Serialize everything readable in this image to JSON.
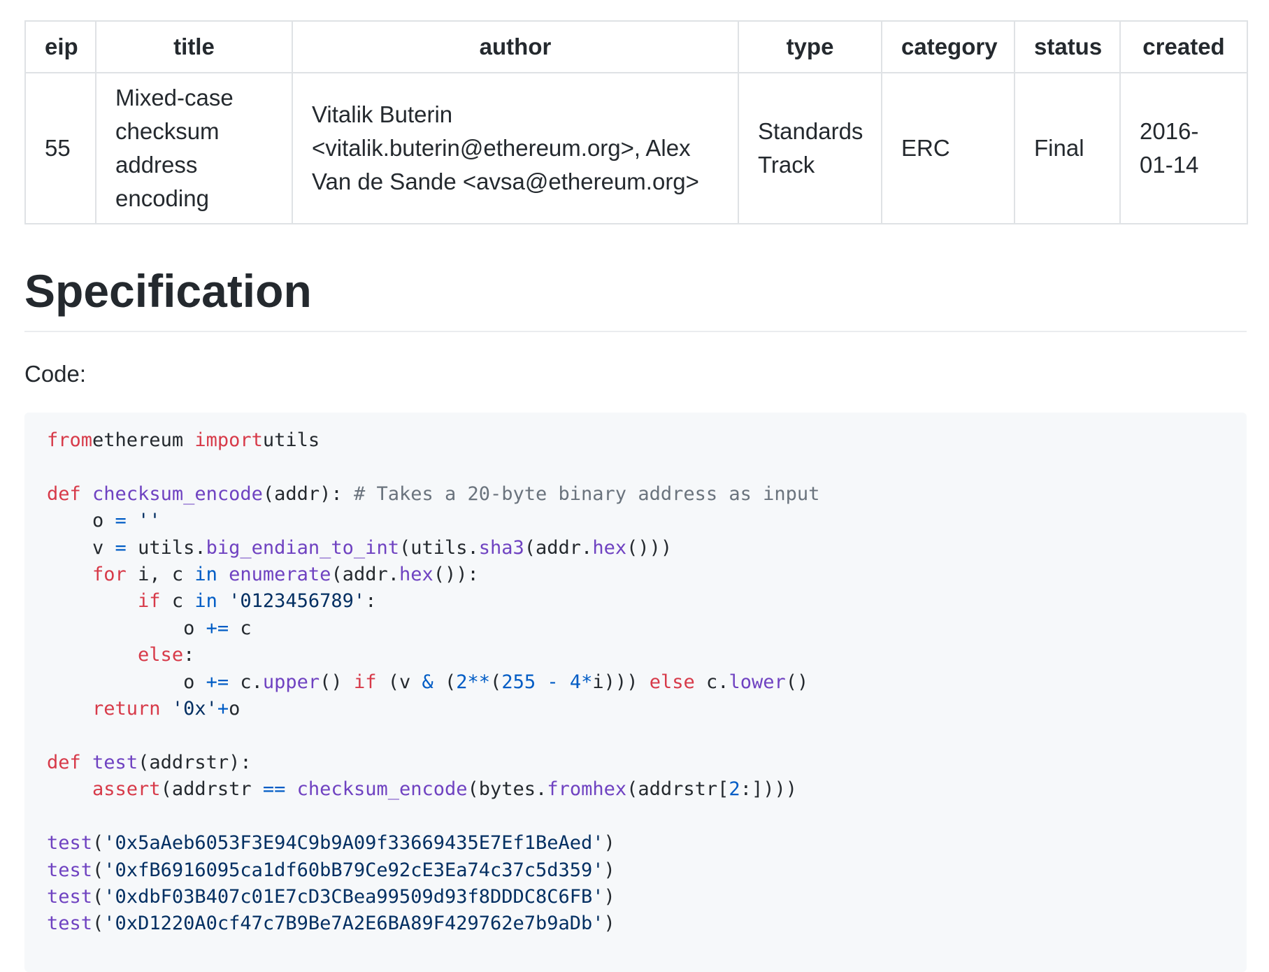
{
  "table": {
    "headers": [
      "eip",
      "title",
      "author",
      "type",
      "category",
      "status",
      "created"
    ],
    "row": {
      "eip": "55",
      "title_lines": [
        "Mixed-case",
        "checksum",
        "address",
        "encoding"
      ],
      "author_lines": [
        "Vitalik Buterin",
        "<vitalik.buterin@ethereum.org>, Alex",
        "Van de Sande <avsa@ethereum.org>"
      ],
      "type_lines": [
        "Standards",
        "Track"
      ],
      "category": "ERC",
      "status": "Final",
      "created_lines": [
        "2016-",
        "01-14"
      ]
    }
  },
  "section_heading": "Specification",
  "code_label": "Code:",
  "code_lines": [
    [
      [
        "k",
        "from"
      ],
      [
        "",
        "ethereum "
      ],
      [
        "k",
        "import"
      ],
      [
        "",
        "utils"
      ]
    ],
    [],
    [
      [
        "k",
        "def"
      ],
      [
        "",
        " "
      ],
      [
        "f",
        "checksum_encode"
      ],
      [
        "",
        "(addr): "
      ],
      [
        "c",
        "# Takes a 20-byte binary address as input"
      ]
    ],
    [
      [
        "",
        "    o "
      ],
      [
        "n",
        "="
      ],
      [
        "",
        " "
      ],
      [
        "s",
        "''"
      ]
    ],
    [
      [
        "",
        "    v "
      ],
      [
        "n",
        "="
      ],
      [
        "",
        " utils."
      ],
      [
        "f",
        "big_endian_to_int"
      ],
      [
        "",
        "(utils."
      ],
      [
        "f",
        "sha3"
      ],
      [
        "",
        "(addr."
      ],
      [
        "f",
        "hex"
      ],
      [
        "",
        "()))"
      ]
    ],
    [
      [
        "",
        "    "
      ],
      [
        "k",
        "for"
      ],
      [
        "",
        " i, c "
      ],
      [
        "n",
        "in"
      ],
      [
        "",
        " "
      ],
      [
        "f",
        "enumerate"
      ],
      [
        "",
        "(addr."
      ],
      [
        "f",
        "hex"
      ],
      [
        "",
        "()):"
      ]
    ],
    [
      [
        "",
        "        "
      ],
      [
        "k",
        "if"
      ],
      [
        "",
        " c "
      ],
      [
        "n",
        "in"
      ],
      [
        "",
        " "
      ],
      [
        "s",
        "'0123456789'"
      ],
      [
        "",
        ":"
      ]
    ],
    [
      [
        "",
        "            o "
      ],
      [
        "n",
        "+="
      ],
      [
        "",
        " c"
      ]
    ],
    [
      [
        "",
        "        "
      ],
      [
        "k",
        "else"
      ],
      [
        "",
        ":"
      ]
    ],
    [
      [
        "",
        "            o "
      ],
      [
        "n",
        "+="
      ],
      [
        "",
        " c."
      ],
      [
        "f",
        "upper"
      ],
      [
        "",
        "() "
      ],
      [
        "k",
        "if"
      ],
      [
        "",
        " (v "
      ],
      [
        "n",
        "&"
      ],
      [
        "",
        " ("
      ],
      [
        "n",
        "2"
      ],
      [
        "n",
        "**"
      ],
      [
        "",
        "("
      ],
      [
        "n",
        "255"
      ],
      [
        "",
        " "
      ],
      [
        "n",
        "-"
      ],
      [
        "",
        " "
      ],
      [
        "n",
        "4"
      ],
      [
        "n",
        "*"
      ],
      [
        "",
        "i))) "
      ],
      [
        "k",
        "else"
      ],
      [
        "",
        " c."
      ],
      [
        "f",
        "lower"
      ],
      [
        "",
        "()"
      ]
    ],
    [
      [
        "",
        "    "
      ],
      [
        "k",
        "return"
      ],
      [
        "",
        " "
      ],
      [
        "s",
        "'0x'"
      ],
      [
        "n",
        "+"
      ],
      [
        "",
        "o"
      ]
    ],
    [],
    [
      [
        "k",
        "def"
      ],
      [
        "",
        " "
      ],
      [
        "f",
        "test"
      ],
      [
        "",
        "(addrstr):"
      ]
    ],
    [
      [
        "",
        "    "
      ],
      [
        "k",
        "assert"
      ],
      [
        "",
        "(addrstr "
      ],
      [
        "n",
        "=="
      ],
      [
        "",
        " "
      ],
      [
        "f",
        "checksum_encode"
      ],
      [
        "",
        "(bytes."
      ],
      [
        "f",
        "fromhex"
      ],
      [
        "",
        "(addrstr["
      ],
      [
        "n",
        "2"
      ],
      [
        "",
        ":])))"
      ]
    ],
    [],
    [
      [
        "f",
        "test"
      ],
      [
        "",
        "("
      ],
      [
        "s",
        "'0x5aAeb6053F3E94C9b9A09f33669435E7Ef1BeAed'"
      ],
      [
        "",
        ")"
      ]
    ],
    [
      [
        "f",
        "test"
      ],
      [
        "",
        "("
      ],
      [
        "s",
        "'0xfB6916095ca1df60bB79Ce92cE3Ea74c37c5d359'"
      ],
      [
        "",
        ")"
      ]
    ],
    [
      [
        "f",
        "test"
      ],
      [
        "",
        "("
      ],
      [
        "s",
        "'0xdbF03B407c01E7cD3CBea99509d93f8DDDC8C6FB'"
      ],
      [
        "",
        ")"
      ]
    ],
    [
      [
        "f",
        "test"
      ],
      [
        "",
        "("
      ],
      [
        "s",
        "'0xD1220A0cf47c7B9Be7A2E6BA89F429762e7b9aDb'"
      ],
      [
        "",
        ")"
      ]
    ]
  ]
}
